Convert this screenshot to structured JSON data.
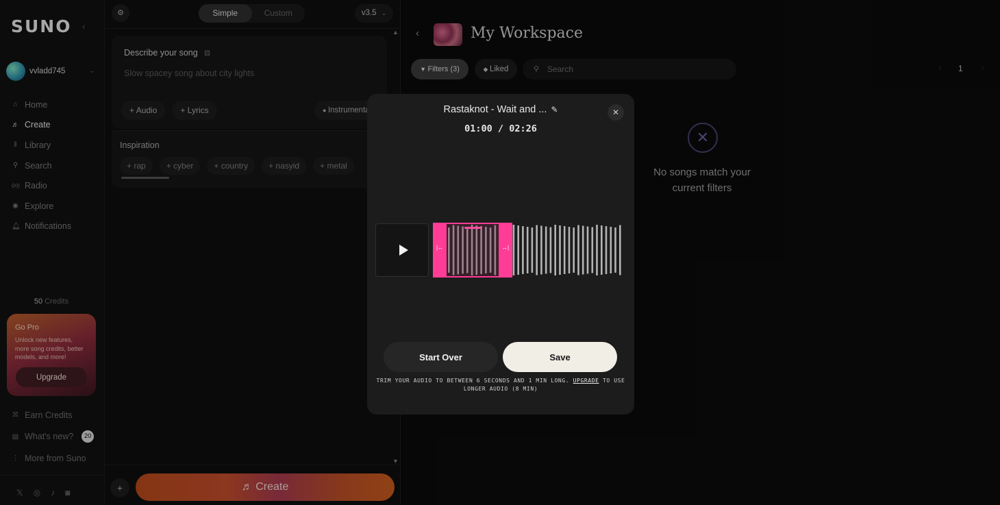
{
  "sidebar": {
    "logo": "SUNO",
    "username": "vvladd745",
    "nav": [
      {
        "icon": "⌂",
        "label": "Home"
      },
      {
        "icon": "♬",
        "label": "Create"
      },
      {
        "icon": "‖",
        "label": "Library"
      },
      {
        "icon": "⚲",
        "label": "Search"
      },
      {
        "icon": "((•))",
        "label": "Radio"
      },
      {
        "icon": "◉",
        "label": "Explore"
      },
      {
        "icon": "🔔︎",
        "label": "Notifications"
      }
    ],
    "credits_count": "50",
    "credits_label": "Credits",
    "gopro": {
      "title": "Go Pro",
      "text": "Unlock new features, more song credits, better models, and more!",
      "button": "Upgrade"
    },
    "bottom": [
      {
        "icon": "⛝",
        "label": "Earn Credits"
      },
      {
        "icon": "▤",
        "label": "What's new?",
        "badge": "20"
      },
      {
        "icon": "⋮",
        "label": "More from Suno"
      }
    ]
  },
  "create_panel": {
    "modes": [
      "Simple",
      "Custom"
    ],
    "version": "v3.5",
    "describe_title": "Describe your song",
    "describe_placeholder": "Slow spacey song about city lights",
    "chips": [
      "Audio",
      "Lyrics"
    ],
    "instrumental": "Instrumenta",
    "inspiration_title": "Inspiration",
    "inspiration": [
      "rap",
      "cyber",
      "country",
      "nasyid",
      "metal"
    ],
    "create_button": "Create"
  },
  "workspace": {
    "title": "My Workspace",
    "filters": "Filters (3)",
    "liked": "Liked",
    "search_placeholder": "Search",
    "page": "1",
    "empty_line1": "No songs match your",
    "empty_line2": "current filters"
  },
  "modal": {
    "title": "Rastaknot - Wait and ...",
    "current_time": "01:00",
    "total_time": "02:26",
    "time_sep": " / ",
    "start_over": "Start Over",
    "save": "Save",
    "note_pre": "TRIM YOUR AUDIO TO BETWEEN 6 SECONDS AND 1 MIN LONG.",
    "note_link": "UPGRADE",
    "note_post": "TO USE LONGER AUDIO (8 MIN)",
    "selection_start_sec": 0,
    "selection_end_sec": 60,
    "accent": "#ff3d96"
  }
}
